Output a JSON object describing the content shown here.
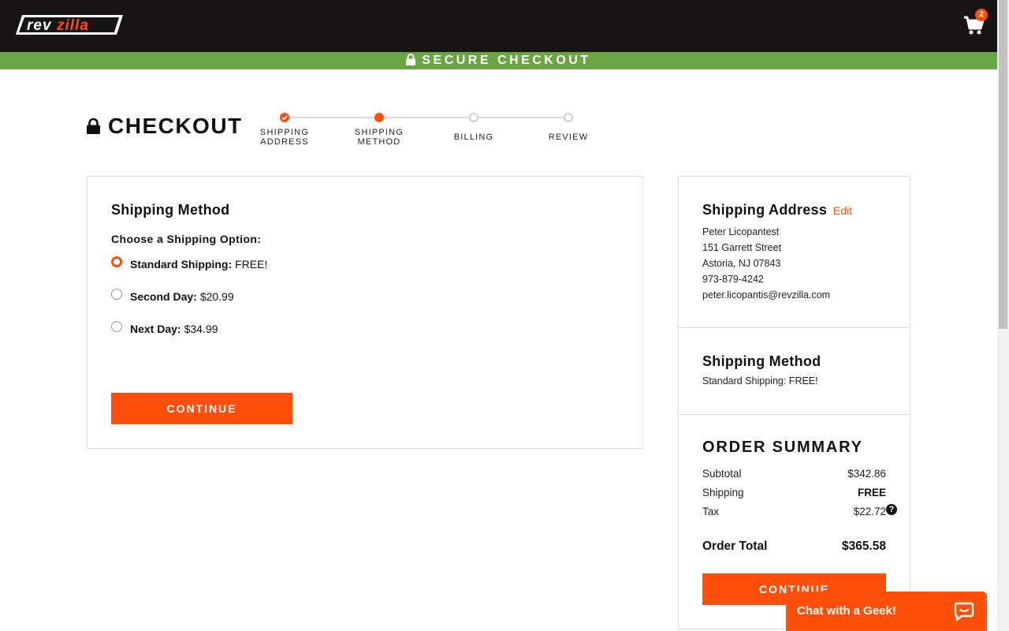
{
  "header": {
    "logo_text": "revzilla",
    "cart_count": "2",
    "secure_label": "SECURE CHECKOUT"
  },
  "checkout": {
    "title": "CHECKOUT",
    "steps": [
      {
        "label_line1": "SHIPPING",
        "label_line2": "ADDRESS",
        "state": "done"
      },
      {
        "label_line1": "SHIPPING",
        "label_line2": "METHOD",
        "state": "active"
      },
      {
        "label_line1": "BILLING",
        "label_line2": "",
        "state": "todo"
      },
      {
        "label_line1": "REVIEW",
        "label_line2": "",
        "state": "todo"
      }
    ]
  },
  "shipping_method": {
    "heading": "Shipping Method",
    "prompt": "Choose a Shipping Option:",
    "options": [
      {
        "name": "Standard Shipping:",
        "price": "FREE!",
        "selected": true
      },
      {
        "name": "Second Day:",
        "price": "$20.99",
        "selected": false
      },
      {
        "name": "Next Day:",
        "price": "$34.99",
        "selected": false
      }
    ],
    "continue_label": "CONTINUE"
  },
  "sidebar": {
    "address_heading": "Shipping Address",
    "edit_label": "Edit",
    "address_lines": [
      "Peter Licopantest",
      "151 Garrett Street",
      "Astoria, NJ 07843",
      "973-879-4242",
      "peter.licopantis@revzilla.com"
    ],
    "method_heading": "Shipping Method",
    "method_value": "Standard Shipping: FREE!",
    "summary_heading": "ORDER SUMMARY",
    "subtotal_label": "Subtotal",
    "subtotal_value": "$342.86",
    "shipping_label": "Shipping",
    "shipping_value": "FREE",
    "tax_label": "Tax",
    "tax_value": "$22.72",
    "tax_help": "?",
    "total_label": "Order Total",
    "total_value": "$365.58",
    "continue_label": "CONTINUE"
  },
  "chat": {
    "label": "Chat with a Geek!"
  },
  "colors": {
    "accent": "#ff4f0a",
    "header_bg": "#171515",
    "secure_bar": "#6ba544"
  }
}
